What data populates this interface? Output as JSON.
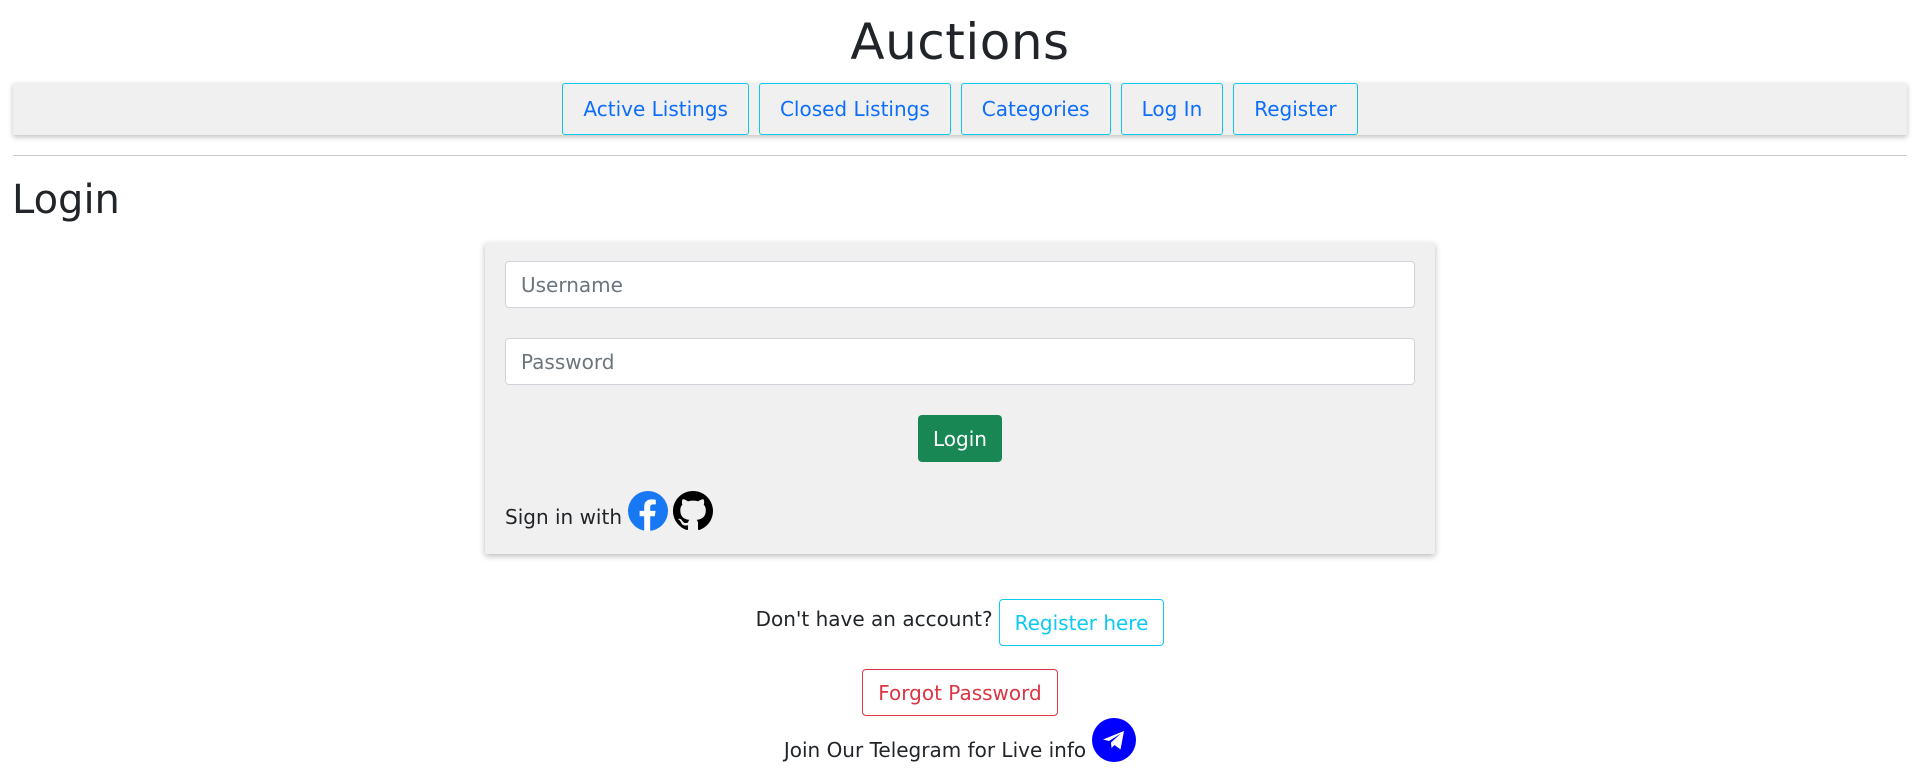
{
  "site": {
    "title": "Auctions"
  },
  "nav": {
    "items": [
      {
        "label": "Active Listings"
      },
      {
        "label": "Closed Listings"
      },
      {
        "label": "Categories"
      },
      {
        "label": "Log In"
      },
      {
        "label": "Register"
      }
    ]
  },
  "page": {
    "heading": "Login"
  },
  "form": {
    "username_placeholder": "Username",
    "username_value": "",
    "password_placeholder": "Password",
    "password_value": "",
    "submit_label": "Login",
    "signin_label": "Sign in with",
    "social": [
      {
        "icon": "facebook-icon",
        "color": "#1877f2"
      },
      {
        "icon": "github-icon",
        "color": "#000000"
      }
    ]
  },
  "account": {
    "prompt": "Don't have an account?",
    "register_label": "Register here"
  },
  "forgot": {
    "label": "Forgot Password"
  },
  "telegram": {
    "text": "Join Our Telegram for Live info",
    "icon": "telegram-icon",
    "color": "#0000ff"
  },
  "colors": {
    "accent_info": "#0dcaf0",
    "link": "#0d6efd",
    "success": "#198754",
    "danger": "#dc3545",
    "panel": "#f0f0f0"
  }
}
